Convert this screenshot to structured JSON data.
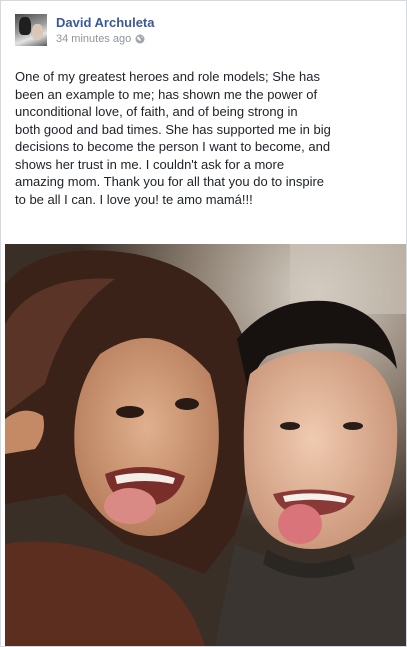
{
  "post": {
    "author": "David Archuleta",
    "timestamp": "34 minutes ago",
    "privacy_icon": "globe-icon",
    "message": "One of my greatest heroes and role models; She has\nbeen an example to me; has shown me the power of\nunconditional love, of faith, and of being strong in\nboth good and bad times. She has supported me in big\ndecisions to become the person I want to become, and\nshows her trust in me. I couldn't ask for a more\namazing mom. Thank you for all that you do to inspire\nto be all I can. I love you! te amo mamá!!!",
    "photo": {
      "icon": "photo-image"
    }
  },
  "colors": {
    "link": "#3b5998",
    "meta": "#90949c",
    "text": "#1d2129",
    "border": "#d4d8e0"
  }
}
